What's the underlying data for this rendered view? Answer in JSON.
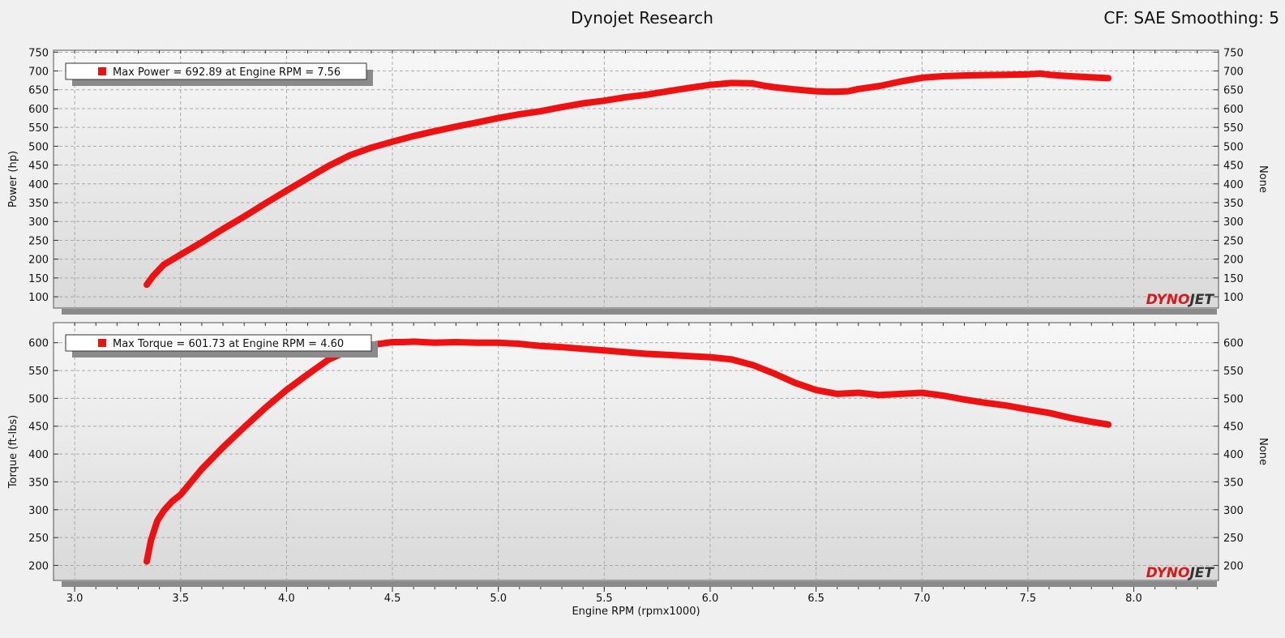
{
  "header": {
    "title": "Dynojet Research",
    "right_info": "CF: SAE Smoothing: 5"
  },
  "colors": {
    "series": "#ee1111",
    "logo_primary": "#d61a1a",
    "logo_secondary": "#333333",
    "plot_bg_top": "#f7f7f7",
    "plot_bg_bottom": "#d9d9d9"
  },
  "branding": {
    "logo_part1": "DYNO",
    "logo_part2": "JET"
  },
  "chart_data": [
    {
      "type": "line",
      "xlabel": "",
      "ylabel": "Power (hp)",
      "right_ylabel": "None",
      "xlim": [
        2.9,
        8.4
      ],
      "ylim": [
        70,
        755
      ],
      "yticks": [
        100,
        150,
        200,
        250,
        300,
        350,
        400,
        450,
        500,
        550,
        600,
        650,
        700,
        750
      ],
      "grid": true,
      "legend": {
        "position": "top-left",
        "text": "Max Power = 692.89 at Engine RPM = 7.56"
      },
      "series": [
        {
          "x": [
            3.34,
            3.37,
            3.42,
            3.5,
            3.6,
            3.7,
            3.8,
            3.9,
            4.0,
            4.1,
            4.2,
            4.3,
            4.4,
            4.5,
            4.6,
            4.7,
            4.8,
            4.9,
            5.0,
            5.1,
            5.2,
            5.3,
            5.4,
            5.5,
            5.6,
            5.7,
            5.8,
            5.9,
            6.0,
            6.1,
            6.2,
            6.25,
            6.3,
            6.4,
            6.5,
            6.55,
            6.6,
            6.65,
            6.7,
            6.8,
            6.9,
            7.0,
            7.1,
            7.2,
            7.3,
            7.4,
            7.5,
            7.56,
            7.6,
            7.7,
            7.8,
            7.88
          ],
          "y": [
            132,
            155,
            185,
            212,
            245,
            280,
            313,
            348,
            382,
            415,
            448,
            476,
            496,
            512,
            527,
            540,
            552,
            563,
            575,
            585,
            593,
            604,
            614,
            621,
            630,
            637,
            646,
            655,
            663,
            668,
            667,
            661,
            657,
            651,
            646,
            645,
            645,
            646,
            652,
            660,
            672,
            682,
            686,
            688,
            689,
            690,
            691,
            693,
            690,
            686,
            683,
            681
          ]
        }
      ]
    },
    {
      "type": "line",
      "xlabel": "Engine RPM (rpmx1000)",
      "ylabel": "Torque (ft-lbs)",
      "right_ylabel": "None",
      "xlim": [
        2.9,
        8.4
      ],
      "ylim": [
        173,
        636
      ],
      "xticks": [
        3.0,
        3.5,
        4.0,
        4.5,
        5.0,
        5.5,
        6.0,
        6.5,
        7.0,
        7.5,
        8.0
      ],
      "yticks": [
        200,
        250,
        300,
        350,
        400,
        450,
        500,
        550,
        600
      ],
      "grid": true,
      "legend": {
        "position": "top-left",
        "text": "Max Torque = 601.73 at Engine RPM = 4.60"
      },
      "series": [
        {
          "x": [
            3.34,
            3.36,
            3.39,
            3.42,
            3.46,
            3.5,
            3.6,
            3.7,
            3.8,
            3.9,
            4.0,
            4.1,
            4.2,
            4.3,
            4.4,
            4.5,
            4.55,
            4.6,
            4.7,
            4.8,
            4.9,
            5.0,
            5.1,
            5.2,
            5.3,
            5.4,
            5.5,
            5.6,
            5.7,
            5.8,
            5.9,
            6.0,
            6.1,
            6.2,
            6.3,
            6.4,
            6.5,
            6.6,
            6.7,
            6.8,
            6.9,
            7.0,
            7.1,
            7.2,
            7.3,
            7.4,
            7.5,
            7.6,
            7.7,
            7.8,
            7.88
          ],
          "y": [
            207,
            245,
            280,
            298,
            315,
            327,
            373,
            412,
            448,
            483,
            515,
            543,
            570,
            587,
            596,
            601,
            601,
            602,
            600,
            601,
            600,
            600,
            598,
            594,
            592,
            589,
            586,
            583,
            580,
            578,
            576,
            574,
            570,
            560,
            545,
            528,
            515,
            508,
            510,
            506,
            508,
            510,
            505,
            498,
            492,
            487,
            480,
            474,
            465,
            458,
            453
          ]
        }
      ]
    }
  ]
}
